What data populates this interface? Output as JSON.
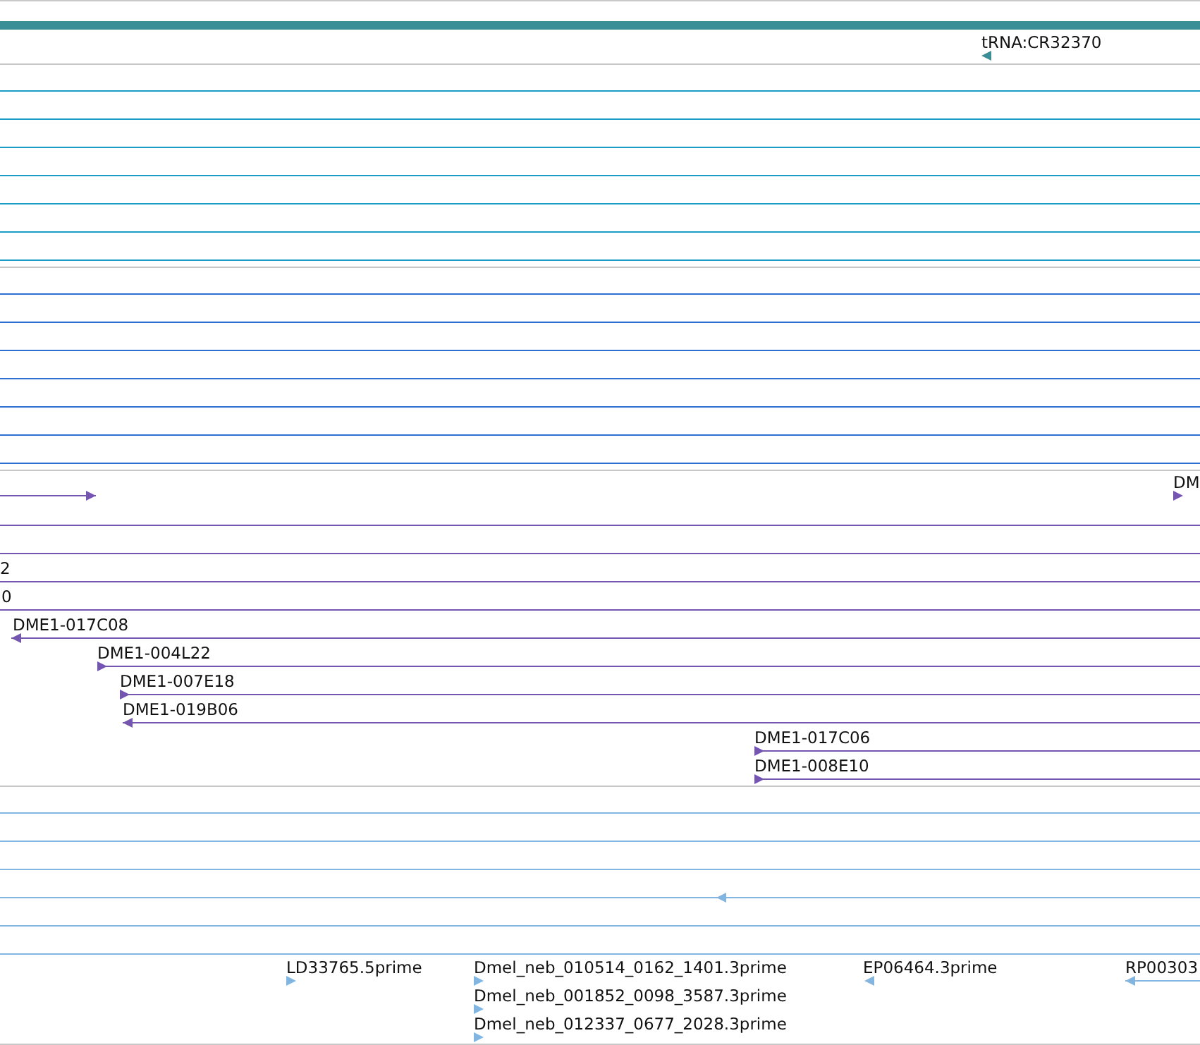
{
  "tracks": [
    {
      "color": "#3a8f96",
      "features": [
        {
          "kind": "bar"
        },
        {
          "kind": "feature",
          "label": "tRNA:CR32370",
          "forward": false
        }
      ]
    },
    {
      "color": "#1a9ec8",
      "features": [
        {
          "kind": "feature"
        },
        {
          "kind": "feature"
        },
        {
          "kind": "feature"
        },
        {
          "kind": "feature"
        },
        {
          "kind": "feature"
        },
        {
          "kind": "feature"
        },
        {
          "kind": "feature"
        }
      ]
    },
    {
      "color": "#2f6fd2",
      "features": [
        {
          "kind": "feature"
        },
        {
          "kind": "feature"
        },
        {
          "kind": "feature"
        },
        {
          "kind": "feature"
        },
        {
          "kind": "feature"
        },
        {
          "kind": "feature"
        },
        {
          "kind": "feature"
        }
      ]
    },
    {
      "color": "#7456b0",
      "features": [
        {
          "kind": "feature",
          "forward": true
        },
        {
          "kind": "feature",
          "label": "DM",
          "forward": true
        },
        {
          "kind": "feature"
        },
        {
          "kind": "feature"
        },
        {
          "kind": "feature",
          "label": "2"
        },
        {
          "kind": "feature",
          "label": "0"
        },
        {
          "kind": "feature",
          "label": "DME1-017C08",
          "forward": false
        },
        {
          "kind": "feature",
          "label": "DME1-004L22",
          "forward": true
        },
        {
          "kind": "feature",
          "label": "DME1-007E18",
          "forward": true
        },
        {
          "kind": "feature",
          "label": "DME1-019B06",
          "forward": false
        },
        {
          "kind": "feature",
          "label": "DME1-017C06",
          "forward": true
        },
        {
          "kind": "feature",
          "label": "DME1-008E10",
          "forward": true
        }
      ]
    },
    {
      "color": "#82b6e0",
      "features": [
        {
          "kind": "feature"
        },
        {
          "kind": "feature"
        },
        {
          "kind": "feature"
        },
        {
          "kind": "feature",
          "forward": false
        },
        {
          "kind": "feature"
        },
        {
          "kind": "feature"
        },
        {
          "kind": "feature",
          "label": "LD33765.5prime",
          "forward": true
        },
        {
          "kind": "feature",
          "label": "Dmel_neb_010514_0162_1401.3prime",
          "forward": true
        },
        {
          "kind": "feature",
          "label": "EP06464.3prime",
          "forward": false
        },
        {
          "kind": "feature",
          "label": "RP00303",
          "forward": false
        },
        {
          "kind": "feature",
          "label": "Dmel_neb_001852_0098_3587.3prime",
          "forward": true
        },
        {
          "kind": "feature",
          "label": "Dmel_neb_012337_0677_2028.3prime",
          "forward": true
        }
      ]
    }
  ]
}
